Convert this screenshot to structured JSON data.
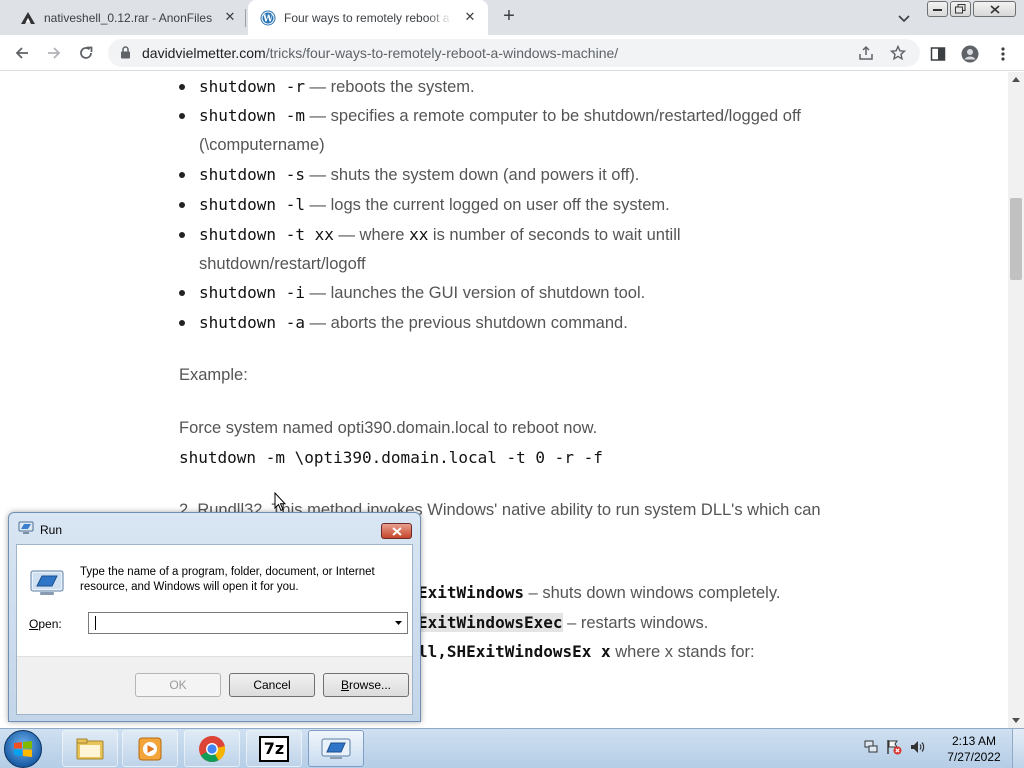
{
  "browser": {
    "tabs": [
      {
        "title": "nativeshell_0.12.rar - AnonFiles",
        "icon": "anonfiles-icon"
      },
      {
        "title": "Four ways to remotely reboot a W",
        "icon": "wordpress-icon"
      }
    ],
    "url_host": "davidvielmetter.com",
    "url_path": "/tricks/four-ways-to-remotely-reboot-a-windows-machine/"
  },
  "article": {
    "options": [
      {
        "cmd": "shutdown -r",
        "desc": " — reboots the system."
      },
      {
        "cmd": "shutdown -m",
        "desc": " — specifies a remote computer to be shutdown/restarted/logged off",
        "desc2": "(\\computername)"
      },
      {
        "cmd": "shutdown -s",
        "desc": " — shuts the system down (and powers it off)."
      },
      {
        "cmd": "shutdown -l",
        "desc": " — logs the current logged on user off the system."
      },
      {
        "cmd": "shutdown -t xx",
        "desc_a": " — where ",
        "code": "xx",
        "desc_b": " is number of seconds to wait untill",
        "desc2": "shutdown/restart/logoff"
      },
      {
        "cmd": "shutdown -i",
        "desc": " — launches the GUI version of shutdown tool."
      },
      {
        "cmd": "shutdown -a",
        "desc": " — aborts the previous shutdown command."
      }
    ],
    "example_label": "Example:",
    "example_text": "Force system named opti390.domain.local to reboot now.",
    "example_cmd": "shutdown -m \\opti390.domain.local -t 0 -r -f",
    "section2": "2. Rundll32. This method invokes Windows' native ability to run system DLL's which can",
    "rundll_items": [
      {
        "code": "ExitWindows",
        "desc": " – shuts down windows completely."
      },
      {
        "code": "ExitWindowsExec",
        "desc": " – restarts windows."
      },
      {
        "code": "ll,SHExitWindowsEx x",
        "desc": "  where x stands for:"
      }
    ]
  },
  "run_dialog": {
    "title": "Run",
    "description": "Type the name of a program, folder, document, or Internet resource, and Windows will open it for you.",
    "open_label_prefix": "",
    "open_label_access": "O",
    "open_label_rest": "pen:",
    "open_value": "",
    "ok_label": "OK",
    "cancel_label": "Cancel",
    "browse_label_access": "B",
    "browse_label_rest": "rowse..."
  },
  "taskbar": {
    "apps": [
      "file-explorer-icon",
      "media-player-icon",
      "chrome-icon",
      "7zip-icon",
      "run-dialog-icon"
    ],
    "seven_zip_text": "7z",
    "time": "2:13 AM",
    "date": "7/27/2022"
  }
}
